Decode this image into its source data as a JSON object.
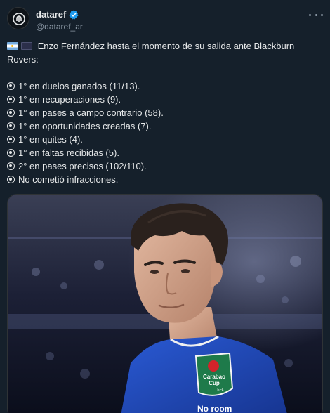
{
  "author": {
    "display_name": "dataref",
    "handle": "@dataref_ar"
  },
  "tweet": {
    "intro": "Enzo Fernández hasta el momento de su salida ante Blackburn Rovers:",
    "stats": [
      "1° en duelos ganados (11/13).",
      "1° en recuperaciones (9).",
      "1° en pases a campo contrario (58).",
      "1° en oportunidades creadas (7).",
      "1° en quites (4).",
      "1° en faltas recibidas (5).",
      "2° en pases precisos (102/110).",
      "No cometió infracciones."
    ]
  },
  "media": {
    "badge_line1": "Carabao",
    "badge_line2": "Cup",
    "badge_efl": "EFL",
    "sponsor": "No room"
  },
  "icons": {
    "verified": "verified-badge-icon",
    "more": "more-options-icon",
    "bullet": "radio-bullet-icon",
    "flag1": "argentina-flag-icon",
    "flag2": "club-flag-icon"
  },
  "colors": {
    "background": "#15202b",
    "text": "#e7e9ea",
    "secondary": "#8b98a5",
    "verified": "#1d9bf0",
    "jersey": "#1f4bbf"
  }
}
